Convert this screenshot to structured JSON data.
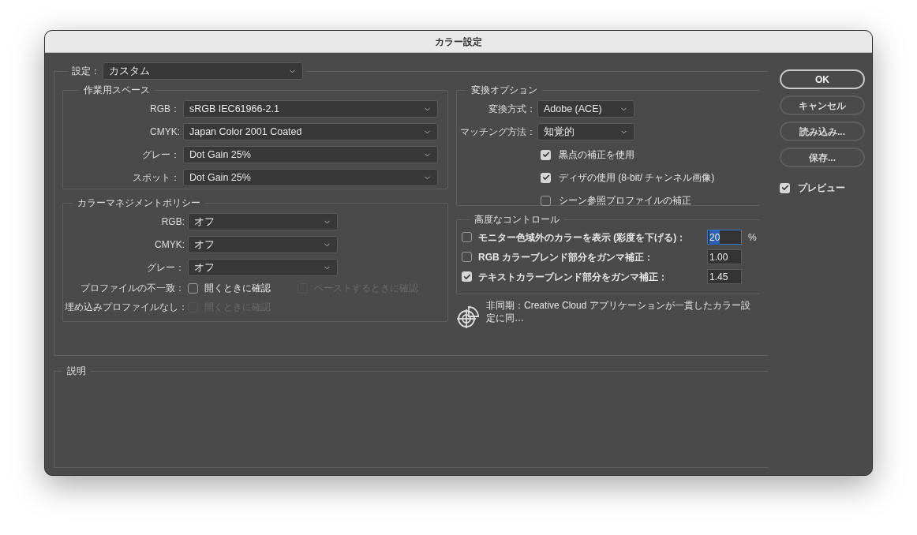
{
  "window": {
    "title": "カラー設定"
  },
  "settings": {
    "label": "設定：",
    "value": "カスタム"
  },
  "working_spaces": {
    "title": "作業用スペース",
    "rows": [
      {
        "label": "RGB：",
        "value": "sRGB IEC61966-2.1"
      },
      {
        "label": "CMYK:",
        "value": "Japan Color 2001 Coated"
      },
      {
        "label": "グレー：",
        "value": "Dot Gain 25%"
      },
      {
        "label": "スポット：",
        "value": "Dot Gain 25%"
      }
    ]
  },
  "policies": {
    "title": "カラーマネジメントポリシー",
    "rows": [
      {
        "label": "RGB:",
        "value": "オフ"
      },
      {
        "label": "CMYK:",
        "value": "オフ"
      },
      {
        "label": "グレー：",
        "value": "オフ"
      }
    ],
    "checks": [
      {
        "label": "プロファイルの不一致：",
        "options": [
          {
            "label": "開くときに確認",
            "checked": false,
            "disabled": false
          },
          {
            "label": "ペーストするときに確認",
            "checked": false,
            "disabled": true
          }
        ]
      },
      {
        "label": "埋め込みプロファイルなし：",
        "options": [
          {
            "label": "開くときに確認",
            "checked": false,
            "disabled": true
          }
        ]
      }
    ]
  },
  "conversion": {
    "title": "変換オプション",
    "rows": [
      {
        "label": "変換方式：",
        "value": "Adobe (ACE)"
      },
      {
        "label": "マッチング方法：",
        "value": "知覚的"
      }
    ],
    "options": [
      {
        "label": "黒点の補正を使用",
        "checked": true
      },
      {
        "label": "ディザの使用 (8-bit/ チャンネル画像)",
        "checked": true
      },
      {
        "label": "シーン参照プロファイルの補正",
        "checked": false
      }
    ]
  },
  "advanced": {
    "title": "高度なコントロール",
    "rows": [
      {
        "label": "モニター色域外のカラーを表示 (彩度を下げる)：",
        "checked": false,
        "value": "20",
        "unit": "%",
        "selected": true
      },
      {
        "label": "RGB カラーブレンド部分をガンマ補正：",
        "checked": false,
        "value": "1.00",
        "selected": false
      },
      {
        "label": "テキストカラーブレンド部分をガンマ補正：",
        "checked": true,
        "value": "1.45",
        "selected": false
      }
    ]
  },
  "sync_status": "非同期：Creative Cloud アプリケーションが一貫したカラー設定に同…",
  "description": {
    "title": "説明"
  },
  "buttons": [
    {
      "label": "OK",
      "default": true
    },
    {
      "label": "キャンセル",
      "default": false
    },
    {
      "label": "読み込み...",
      "default": false
    },
    {
      "label": "保存...",
      "default": false
    }
  ],
  "preview": {
    "label": "プレビュー",
    "checked": true
  }
}
